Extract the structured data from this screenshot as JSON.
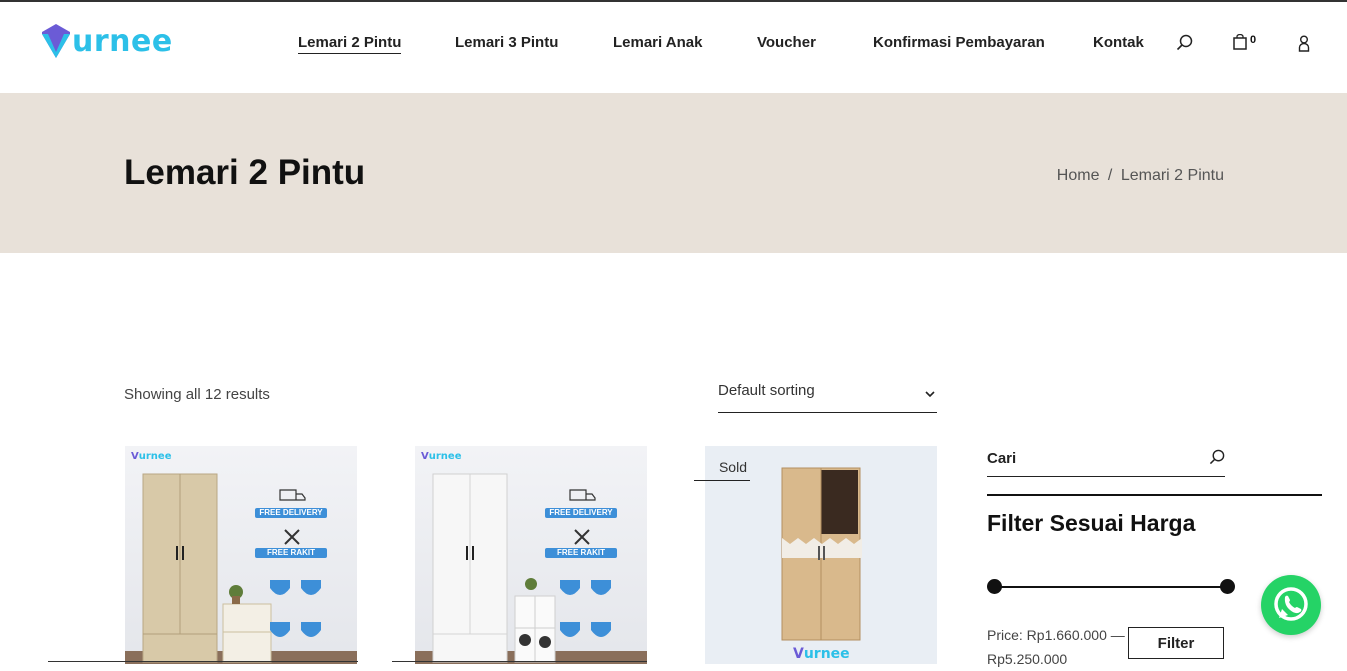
{
  "header": {
    "logo_text": "urnee",
    "nav": [
      {
        "label": "Lemari 2 Pintu",
        "active": true
      },
      {
        "label": "Lemari 3 Pintu"
      },
      {
        "label": "Lemari Anak"
      },
      {
        "label": "Voucher"
      },
      {
        "label": "Konfirmasi Pembayaran"
      },
      {
        "label": "Kontak"
      }
    ],
    "cart_count": "0"
  },
  "banner": {
    "title": "Lemari 2 Pintu",
    "breadcrumb": {
      "home": "Home",
      "separator": "/",
      "current": "Lemari 2 Pintu"
    }
  },
  "shop": {
    "result_count": "Showing all 12 results",
    "sort_selected": "Default sorting",
    "products": [
      {
        "badge_logo": "urnee",
        "tags": [
          "FREE DELIVERY",
          "FREE RAKIT"
        ],
        "wardrobe_color": "#d8c9a8"
      },
      {
        "badge_logo": "urnee",
        "tags": [
          "FREE DELIVERY",
          "FREE RAKIT"
        ],
        "wardrobe_color": "#f4f4f4"
      },
      {
        "sold_label": "Sold",
        "brand": "urnee",
        "wardrobe_color": "#d9b98c"
      }
    ]
  },
  "sidebar": {
    "search_placeholder": "Cari",
    "filter_title": "Filter Sesuai Harga",
    "price_label": "Price: Rp1.660.000 — Rp5.250.000",
    "filter_button": "Filter"
  },
  "colors": {
    "accent": "#2cc0e8",
    "logo_purple": "#6b5bd6",
    "banner_bg": "#e8e1d9",
    "whatsapp": "#25d366"
  }
}
